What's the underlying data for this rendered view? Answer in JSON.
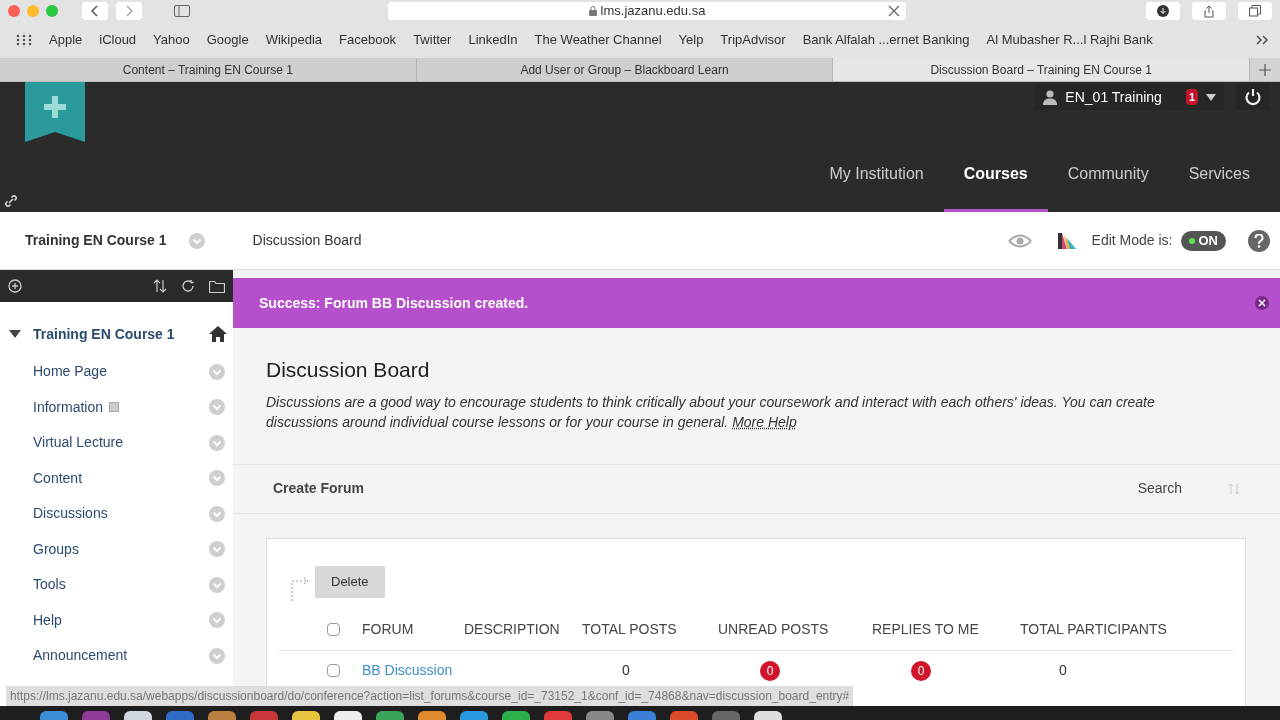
{
  "browser": {
    "url": "lms.jazanu.edu.sa",
    "bookmarks": [
      "Apple",
      "iCloud",
      "Yahoo",
      "Google",
      "Wikipedia",
      "Facebook",
      "Twitter",
      "LinkedIn",
      "The Weather Channel",
      "Yelp",
      "TripAdvisor",
      "Bank Alfalah ...ernet Banking",
      "Al Mubasher R...l Rajhi Bank"
    ],
    "tabs": [
      {
        "label": "Content – Training EN Course 1",
        "selected": false
      },
      {
        "label": "Add User or Group – Blackboard Learn",
        "selected": false
      },
      {
        "label": "Discussion Board – Training EN Course 1",
        "selected": true
      }
    ]
  },
  "header": {
    "user": "EN_01 Training",
    "notifications": "1",
    "nav": [
      {
        "label": "My Institution",
        "selected": false
      },
      {
        "label": "Courses",
        "selected": true
      },
      {
        "label": "Community",
        "selected": false
      },
      {
        "label": "Services",
        "selected": false
      }
    ]
  },
  "course_bar": {
    "course": "Training EN Course 1",
    "page": "Discussion Board",
    "edit_mode_label": "Edit Mode is:",
    "edit_mode": {
      "on": true,
      "label": "ON"
    }
  },
  "sidebar": {
    "course": {
      "label": "Training EN Course 1",
      "expanded": true
    },
    "items": [
      {
        "label": "Home Page",
        "empty": false
      },
      {
        "label": "Information",
        "empty": true
      },
      {
        "label": "Virtual Lecture",
        "empty": false
      },
      {
        "label": "Content",
        "empty": false
      },
      {
        "label": "Discussions",
        "empty": false
      },
      {
        "label": "Groups",
        "empty": false
      },
      {
        "label": "Tools",
        "empty": false
      },
      {
        "label": "Help",
        "empty": false
      },
      {
        "label": "Announcement",
        "empty": false
      }
    ]
  },
  "alert": {
    "text": "Success: Forum BB Discussion created."
  },
  "main": {
    "title": "Discussion Board",
    "description": "Discussions are a good way to encourage students to think critically about your coursework and interact with each others' ideas. You can create discussions around individual course lessons or for your course in general.",
    "help_link": "More Help"
  },
  "action_bar": {
    "create": "Create Forum",
    "search": "Search"
  },
  "table": {
    "delete": "Delete",
    "all_checked": false,
    "columns": [
      "FORUM",
      "DESCRIPTION",
      "TOTAL POSTS",
      "UNREAD POSTS",
      "REPLIES TO ME",
      "TOTAL PARTICIPANTS"
    ],
    "rows": [
      {
        "forum": "BB Discussion",
        "checked": false,
        "total_posts": "0",
        "unread_posts": "0",
        "replies_to_me": "0",
        "total_participants": "0"
      }
    ]
  },
  "status_url": "https://lms.jazanu.edu.sa/webapps/discussionboard/do/conference?action=list_forums&course_id=_73152_1&conf_id=_74868&nav=discussion_board_entry#"
}
